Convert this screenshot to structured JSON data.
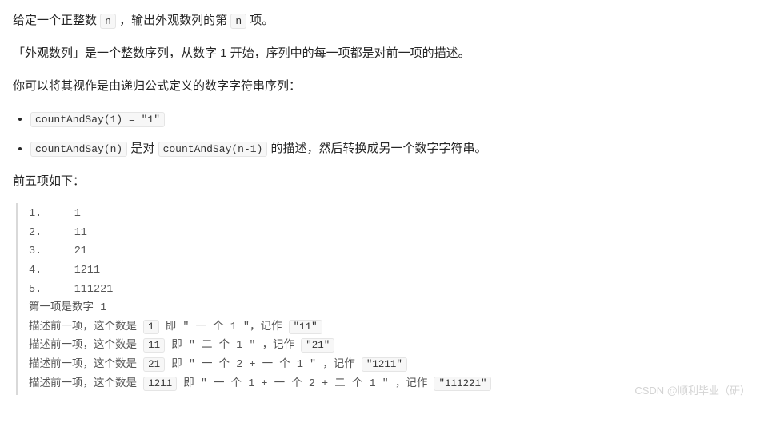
{
  "p1_a": "给定一个正整数 ",
  "p1_n": "n",
  "p1_b": " ，输出外观数列的第 ",
  "p1_n2": "n",
  "p1_c": " 项。",
  "p2": "「外观数列」是一个整数序列，从数字 1 开始，序列中的每一项都是对前一项的描述。",
  "p3": "你可以将其视作是由递归公式定义的数字字符串序列：",
  "li1": "countAndSay(1) = \"1\"",
  "li2_a": "countAndSay(n)",
  "li2_b": " 是对 ",
  "li2_c": "countAndSay(n-1)",
  "li2_d": " 的描述，然后转换成另一个数字字符串。",
  "p4": "前五项如下：",
  "seq1": "1.     1",
  "seq2": "2.     11",
  "seq3": "3.     21",
  "seq4": "4.     1211",
  "seq5": "5.     111221",
  "d0": "第一项是数字 1",
  "d1a": "描述前一项，这个数是 ",
  "d1n": "1",
  "d1b": " 即 \" 一 个 1 \"，记作 ",
  "d1r": "\"11\"",
  "d2a": "描述前一项，这个数是 ",
  "d2n": "11",
  "d2b": " 即 \" 二 个 1 \" ，记作 ",
  "d2r": "\"21\"",
  "d3a": "描述前一项，这个数是 ",
  "d3n": "21",
  "d3b": " 即 \" 一 个 2 + 一 个 1 \" ，记作 ",
  "d3r": "\"1211\"",
  "d4a": "描述前一项，这个数是 ",
  "d4n": "1211",
  "d4b": " 即 \" 一 个 1 + 一 个 2 + 二 个 1 \" ，记作 ",
  "d4r": "\"111221\"",
  "watermark": "CSDN @顺利毕业（研）"
}
